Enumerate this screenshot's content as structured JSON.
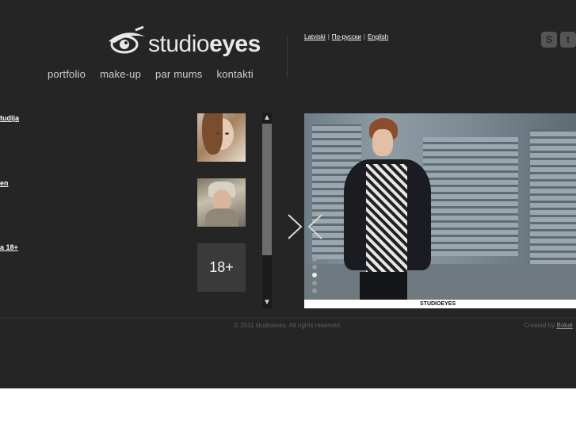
{
  "brand": {
    "logo_light": "studio",
    "logo_bold": "eyes"
  },
  "nav": [
    {
      "label": "portfolio"
    },
    {
      "label": "make-up"
    },
    {
      "label": "par mums"
    },
    {
      "label": "kontakti"
    }
  ],
  "languages": [
    {
      "label": "Latviski"
    },
    {
      "label": "По-русски"
    },
    {
      "label": "English"
    }
  ],
  "social": [
    {
      "icon": "skype-icon"
    },
    {
      "icon": "twitter-icon"
    }
  ],
  "categories": [
    {
      "label": "tudija"
    },
    {
      "label": "en"
    },
    {
      "label": "a 18+"
    }
  ],
  "thumbnails": [
    {
      "label": ""
    },
    {
      "label": ""
    },
    {
      "label": "18+"
    }
  ],
  "hero": {
    "watermark": "STUDIOEYES",
    "slide_count": 5,
    "active_slide": 2
  },
  "footer": {
    "copyright": "© 2011 studioeyes. All rights reserved.",
    "created_prefix": "Created by",
    "created_link": "Bokat"
  },
  "colors": {
    "background": "#252525",
    "accent_text": "#ffffff"
  }
}
